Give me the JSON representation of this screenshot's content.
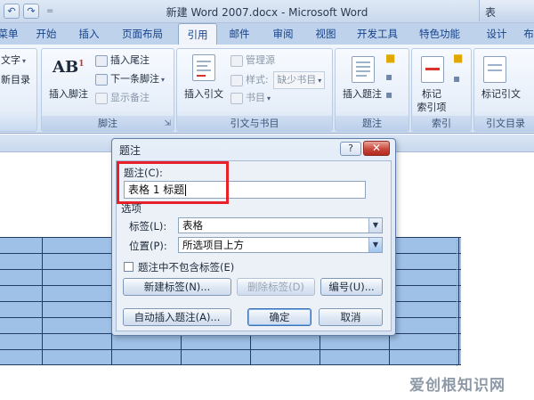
{
  "window": {
    "title": "新建 Word 2007.docx - Microsoft Word",
    "right_fragment": "表"
  },
  "quick_access": {
    "undo": "↶",
    "redo": "↷",
    "separator": "="
  },
  "tabs": [
    {
      "label": "菜单"
    },
    {
      "label": "开始"
    },
    {
      "label": "插入"
    },
    {
      "label": "页面布局"
    },
    {
      "label": "引用",
      "active": true
    },
    {
      "label": "邮件"
    },
    {
      "label": "审阅"
    },
    {
      "label": "视图"
    },
    {
      "label": "开发工具"
    },
    {
      "label": "特色功能"
    },
    {
      "label": "设计"
    },
    {
      "label": "布"
    }
  ],
  "ribbon": {
    "toc": {
      "item1": "文字",
      "item2": "新目录"
    },
    "footnotes": {
      "insert_footnote": "插入脚注",
      "insert_endnote": "插入尾注",
      "next_footnote": "下一条脚注",
      "show_notes": "显示备注",
      "group_label": "脚注"
    },
    "citations": {
      "insert_citation": "插入引文",
      "manage_sources": "管理源",
      "style_label": "样式:",
      "style_value": "缺少书目",
      "bibliography": "书目",
      "group_label": "引文与书目"
    },
    "captions": {
      "insert_caption": "插入题注",
      "group_label": "题注"
    },
    "index": {
      "mark_entry_line1": "标记",
      "mark_entry_line2": "索引项",
      "group_label": "索引"
    },
    "toa": {
      "mark_citation": "标记引文",
      "group_label": "引文目录"
    }
  },
  "dialog": {
    "title": "题注",
    "help": "?",
    "close": "✕",
    "caption_label": "题注(C):",
    "caption_value": "表格 1 标题",
    "options_label": "选项",
    "label_field": "标签(L):",
    "label_value": "表格",
    "position_field": "位置(P):",
    "position_value": "所选项目上方",
    "exclude_label_checkbox": "题注中不包含标签(E)",
    "exclude_label_checked": false,
    "new_label_button": "新建标签(N)...",
    "delete_label_button": "删除标签(D)",
    "numbering_button": "编号(U)...",
    "autocaption_button": "自动插入题注(A)...",
    "ok_button": "确定",
    "cancel_button": "取消"
  },
  "watermark": "爱创根知识网",
  "colors": {
    "accent": "#15428b",
    "highlight_border": "#e8202a",
    "table_fill": "#9fc1e8",
    "close_button": "#c9473b"
  }
}
